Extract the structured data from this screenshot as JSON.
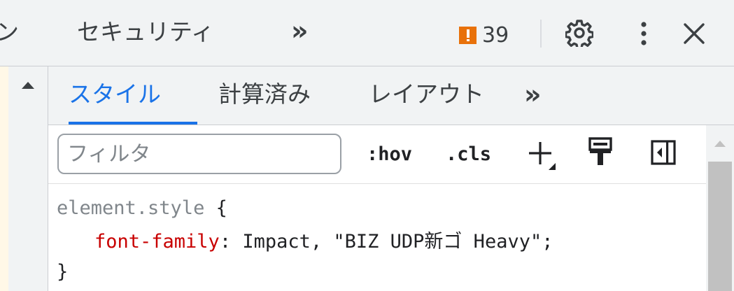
{
  "top_tabs": {
    "cut_tab_label": "ン",
    "security_label": "セキュリティ",
    "more_tabs_label": "»",
    "issues_count": "39"
  },
  "sub_tabs": {
    "items": [
      {
        "label": "スタイル",
        "active": true
      },
      {
        "label": "計算済み",
        "active": false
      },
      {
        "label": "レイアウト",
        "active": false
      }
    ],
    "more_label": "»"
  },
  "toolbar": {
    "filter_placeholder": "フィルタ",
    "hov_label": ":hov",
    "cls_label": ".cls"
  },
  "styles": {
    "selector": "element.style",
    "open_brace": "{",
    "property": "font-family",
    "colon": ":",
    "value": "Impact, \"BIZ UDP新ゴ Heavy\";",
    "close_brace": "}"
  },
  "colors": {
    "accent": "#1a73e8",
    "issue_badge": "#e8710a",
    "css_property": "#c80000",
    "background": "#fff8e7"
  },
  "icons": [
    "issue-flag-icon",
    "gear-icon",
    "kebab-menu-icon",
    "close-icon",
    "scroll-up-arrow-icon",
    "plus-icon",
    "paint-roller-icon",
    "sidebar-toggle-icon"
  ]
}
